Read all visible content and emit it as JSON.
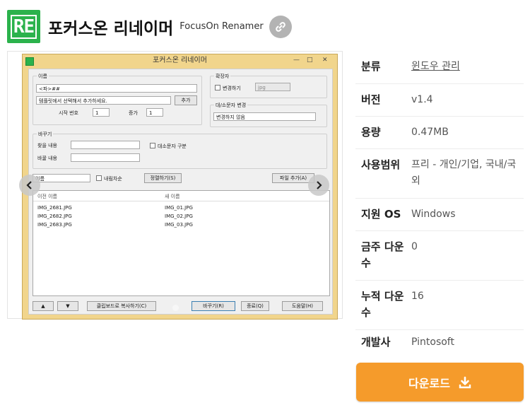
{
  "header": {
    "logo_text": "RE",
    "title": "포커스온 리네이머",
    "subtitle": "FocusOn Renamer",
    "link_icon": "link-icon"
  },
  "preview": {
    "window_title": "포커스온 리네이머",
    "name_group": "이름",
    "name_value": "<파>##",
    "template_select": "템플릿에서 선택해서 추가하세요.",
    "add_button": "추가",
    "start_label": "시작 번호",
    "start_value": "1",
    "increment_label": "증가",
    "increment_value": "1",
    "ext_group": "확장자",
    "ext_change_label": "변경하기",
    "ext_value": "jpg",
    "case_group": "대/소문자 변경",
    "case_select": "변경하지 않음",
    "replace_group": "바꾸기",
    "find_label": "찾을 내용",
    "replace_label": "바꿀 내용",
    "case_sensitive_label": "대소문자 구분",
    "sort_select": "이름",
    "desc_label": "내림차순",
    "sort_button": "정렬하기(S)",
    "add_files_button": "파일 추가(A)",
    "col_old": "이전 이름",
    "col_new": "새 이름",
    "files": [
      {
        "old": "IMG_2681.JPG",
        "new": "IMG_01.JPG"
      },
      {
        "old": "IMG_2682.JPG",
        "new": "IMG_02.JPG"
      },
      {
        "old": "IMG_2683.JPG",
        "new": "IMG_03.JPG"
      }
    ],
    "up_button": "▲",
    "down_button": "▼",
    "clipboard_button": "클립보드로 복사하기(C)",
    "rename_button": "바꾸기(R)",
    "exit_button": "종료(Q)",
    "help_button": "도움말(H)"
  },
  "info": {
    "category_label": "분류",
    "category_value": "윈도우 관리",
    "version_label": "버전",
    "version_value": "v1.4",
    "size_label": "용량",
    "size_value": "0.47MB",
    "license_label": "사용범위",
    "license_value": "프리 - 개인/기업, 국내/국외",
    "os_label": "지원 OS",
    "os_value": "Windows",
    "weekly_label": "금주 다운수",
    "weekly_value": "0",
    "total_label": "누적 다운수",
    "total_value": "16",
    "developer_label": "개발사",
    "developer_value": "Pintosoft"
  },
  "download": {
    "label": "다운로드",
    "icon": "download-icon"
  },
  "colors": {
    "logo_green": "#2bb24c",
    "download_orange": "#f59b2b"
  }
}
